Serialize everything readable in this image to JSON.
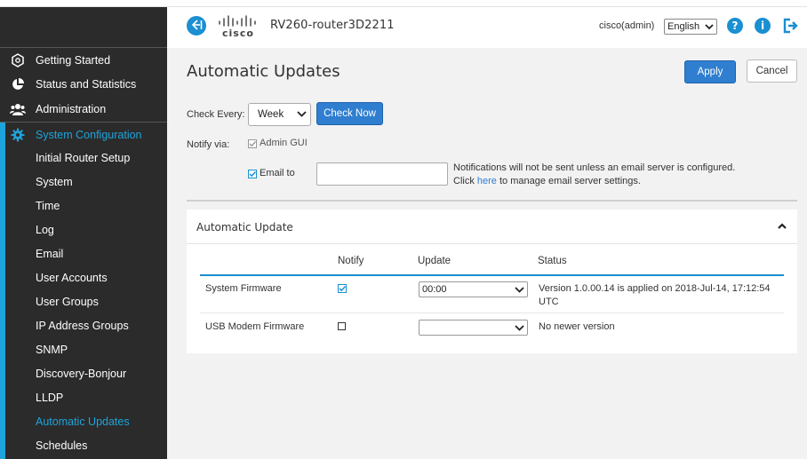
{
  "header": {
    "logo_text": "cisco",
    "device_name": "RV260-router3D2211",
    "user": "cisco(admin)",
    "language": "English",
    "accent_color": "#1a8fd1"
  },
  "sidebar": {
    "items": [
      {
        "label": "Getting Started",
        "icon": "getting-started-icon"
      },
      {
        "label": "Status and Statistics",
        "icon": "pie-chart-icon"
      },
      {
        "label": "Administration",
        "icon": "users-icon"
      },
      {
        "label": "System Configuration",
        "icon": "gear-icon",
        "active": true
      }
    ],
    "subitems": [
      "Initial Router Setup",
      "System",
      "Time",
      "Log",
      "Email",
      "User Accounts",
      "User Groups",
      "IP Address Groups",
      "SNMP",
      "Discovery-Bonjour",
      "LLDP",
      "Automatic Updates",
      "Schedules"
    ],
    "active_subitem": "Automatic Updates"
  },
  "main": {
    "title": "Automatic Updates",
    "apply_label": "Apply",
    "cancel_label": "Cancel",
    "check_every_label": "Check Every:",
    "check_every_value": "Week",
    "check_now_label": "Check Now",
    "notify_via_label": "Notify via:",
    "admin_gui_label": "Admin GUI",
    "admin_gui_checked": true,
    "email_to_label": "Email to",
    "email_to_checked": true,
    "email_value": "",
    "note_line1": "Notifications will not be sent unless an email server is configured.",
    "note_line2_pre": "Click",
    "note_link": "here",
    "note_line2_post": "to manage email server settings."
  },
  "panel": {
    "title": "Automatic Update",
    "columns": [
      "Notify",
      "Update",
      "Status"
    ],
    "rows": [
      {
        "name": "System Firmware",
        "notify": true,
        "update": "00:00",
        "status": "Version 1.0.00.14 is applied on 2018-Jul-14, 17:12:54 UTC"
      },
      {
        "name": "USB Modem Firmware",
        "notify": false,
        "update": "",
        "status": "No newer version"
      }
    ]
  }
}
